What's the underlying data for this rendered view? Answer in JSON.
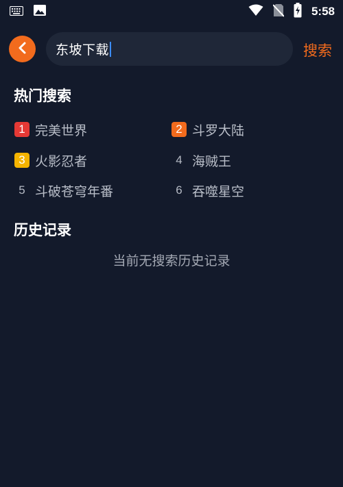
{
  "status_bar": {
    "time": "5:58",
    "icons": [
      "keyboard-icon",
      "image-icon",
      "wifi-icon",
      "no-sim-icon",
      "battery-charging-icon"
    ]
  },
  "header": {
    "search_value": "东坡下载",
    "search_action_label": "搜索",
    "accent_color": "#f26b1d"
  },
  "hot_search": {
    "title": "热门搜索",
    "items": [
      {
        "rank": "1",
        "label": "完美世界",
        "badge_color": "#e53935"
      },
      {
        "rank": "2",
        "label": "斗罗大陆",
        "badge_color": "#f26b1d"
      },
      {
        "rank": "3",
        "label": "火影忍者",
        "badge_color": "#f5b400"
      },
      {
        "rank": "4",
        "label": "海贼王",
        "badge_color": ""
      },
      {
        "rank": "5",
        "label": "斗破苍穹年番",
        "badge_color": ""
      },
      {
        "rank": "6",
        "label": "吞噬星空",
        "badge_color": ""
      }
    ]
  },
  "history": {
    "title": "历史记录",
    "empty_text": "当前无搜索历史记录"
  }
}
